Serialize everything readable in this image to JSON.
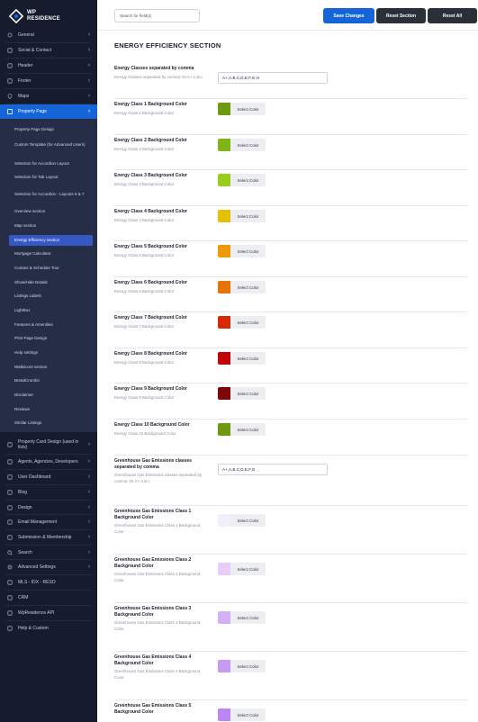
{
  "logo": {
    "line1": "WP",
    "line2": "RESIDENCE"
  },
  "sidebar": {
    "items": [
      {
        "label": "General",
        "icon": "settings-icon",
        "caret": "˅"
      },
      {
        "label": "Social & Contact",
        "icon": "social-icon",
        "caret": "˅"
      },
      {
        "label": "Header",
        "icon": "header-icon",
        "caret": "˅"
      },
      {
        "label": "Footer",
        "icon": "footer-icon",
        "caret": "˅"
      },
      {
        "label": "Maps",
        "icon": "map-pin-icon",
        "caret": "˅"
      },
      {
        "label": "Property Page",
        "icon": "property-page-icon",
        "caret": "˄"
      }
    ],
    "submenu": [
      "Property Page Design",
      "Custom Template (for Advanced Users)",
      "Selection for Accordion Layout",
      "Selection for Tab Layout",
      "Selection for Accordion - Layouts 6 & 7",
      "Overview section",
      "Map section",
      "Energy Efficiency section",
      "Mortgage Calculator",
      "Contact & Schedule Tour",
      "Show/Hide Details",
      "Listings Labels",
      "LightBox",
      "Features & Amenities",
      "Print Page Design",
      "Help settings",
      "Walkscore section",
      "BreadCrumbs",
      "Disclaimer",
      "Reviews",
      "Similar Listings"
    ],
    "items_bottom": [
      {
        "label": "Property Card Design (used in lists)",
        "icon": "card-icon",
        "caret": "˅"
      },
      {
        "label": "Agents, Agencies, Developers",
        "icon": "agents-icon",
        "caret": "˅"
      },
      {
        "label": "User Dashboard",
        "icon": "dashboard-icon",
        "caret": "˅"
      },
      {
        "label": "Blog",
        "icon": "blog-icon",
        "caret": "˅"
      },
      {
        "label": "Design",
        "icon": "design-icon",
        "caret": "˅"
      },
      {
        "label": "Email Management",
        "icon": "email-icon",
        "caret": "˅"
      },
      {
        "label": "Submission & Membership",
        "icon": "submission-icon",
        "caret": "˅"
      },
      {
        "label": "Search",
        "icon": "search-icon",
        "caret": "˅"
      },
      {
        "label": "Advanced Settings",
        "icon": "gear-icon",
        "caret": "˅"
      },
      {
        "label": "MLS - IDX - RESO",
        "icon": "mls-icon",
        "caret": ""
      },
      {
        "label": "CRM",
        "icon": "crm-icon",
        "caret": ""
      },
      {
        "label": "WpResidence API",
        "icon": "api-icon",
        "caret": ""
      },
      {
        "label": "Help & Custom",
        "icon": "help-icon",
        "caret": ""
      }
    ]
  },
  "topbar": {
    "search_placeholder": "Search for field(s)",
    "save_label": "Save Changes",
    "reset_section_label": "Reset Section",
    "reset_all_label": "Reset All"
  },
  "colors": {
    "accent": "#1565d8",
    "sidebar_bg": "#161b2e",
    "submenu_bg": "#262d47",
    "dark_button": "#2b2f3a"
  },
  "section_title": "ENERGY EFFICIENCY SECTION",
  "fields": [
    {
      "type": "text",
      "label": "Energy Classes separated by comma",
      "desc": "Energy Classes separated by comma: Dr.A+,A,B,c",
      "value": "A+,A,B,C,D,E,F,G,H"
    },
    {
      "type": "color",
      "label": "Energy Class 1 Background Color",
      "desc": "Energy Class 1 Background Color",
      "color": "#6f990e",
      "button": "Select Color"
    },
    {
      "type": "color",
      "label": "Energy Class 2 Background Color",
      "desc": "Energy Class 2 Background Color",
      "color": "#80b51a",
      "button": "Select Color"
    },
    {
      "type": "color",
      "label": "Energy Class 3 Background Color",
      "desc": "Energy Class 3 Background Color",
      "color": "#9acd1c",
      "button": "Select Color"
    },
    {
      "type": "color",
      "label": "Energy Class 4 Background Color",
      "desc": "Energy Class 4 Background Color",
      "color": "#e6c000",
      "button": "Select Color"
    },
    {
      "type": "color",
      "label": "Energy Class 5 Background Color",
      "desc": "Energy Class 5 Background Color",
      "color": "#ee9a0a",
      "button": "Select Color"
    },
    {
      "type": "color",
      "label": "Energy Class 6 Background Color",
      "desc": "Energy Class 6 Background Color",
      "color": "#e47406",
      "button": "Select Color"
    },
    {
      "type": "color",
      "label": "Energy Class 7 Background Color",
      "desc": "Energy Class 7 Background Color",
      "color": "#d82906",
      "button": "Select Color"
    },
    {
      "type": "color",
      "label": "Energy Class 8 Background Color",
      "desc": "Energy Class 8 Background Color",
      "color": "#c10404",
      "button": "Select Color"
    },
    {
      "type": "color",
      "label": "Energy Class 9 Background Color",
      "desc": "Energy Class 9 Background Color",
      "color": "#7e0707",
      "button": "Select Color"
    },
    {
      "type": "color",
      "label": "Energy Class 10 Background Color",
      "desc": "Energy Class 10 Background Color",
      "color": "#6f990e",
      "button": "Select Color"
    },
    {
      "type": "text",
      "label": "Greenhouse Gas Emissions classes separated by comma",
      "desc": "Greenhouse Gas Emissions classes separated by comma: Dr.A+,A,B,c",
      "value": "A+,A,B,C,D,E,F,G"
    },
    {
      "type": "color",
      "label": "Greenhouse Gas Emissions Class 1 Background Color",
      "desc": "Greenhouse Gas Emissions Class 1 Background Color",
      "color": "#f3eefc",
      "button": "Select Color"
    },
    {
      "type": "color",
      "label": "Greenhouse Gas Emissions Class 2 Background Color",
      "desc": "Greenhouse Gas Emissions Class 2 Background Color",
      "color": "#e6cdfa",
      "button": "Select Color"
    },
    {
      "type": "color",
      "label": "Greenhouse Gas Emissions Class 3 Background Color",
      "desc": "Greenhouse Gas Emissions Class 3 Background Color",
      "color": "#d6b0f5",
      "button": "Select Color"
    },
    {
      "type": "color",
      "label": "Greenhouse Gas Emissions Class 4 Background Color",
      "desc": "Greenhouse Gas Emissions Class 4 Background Color",
      "color": "#c99af2",
      "button": "Select Color"
    },
    {
      "type": "color",
      "label": "Greenhouse Gas Emissions Class 5 Background Color",
      "desc": "",
      "color": "#bb86ef",
      "button": "Select Color"
    }
  ]
}
